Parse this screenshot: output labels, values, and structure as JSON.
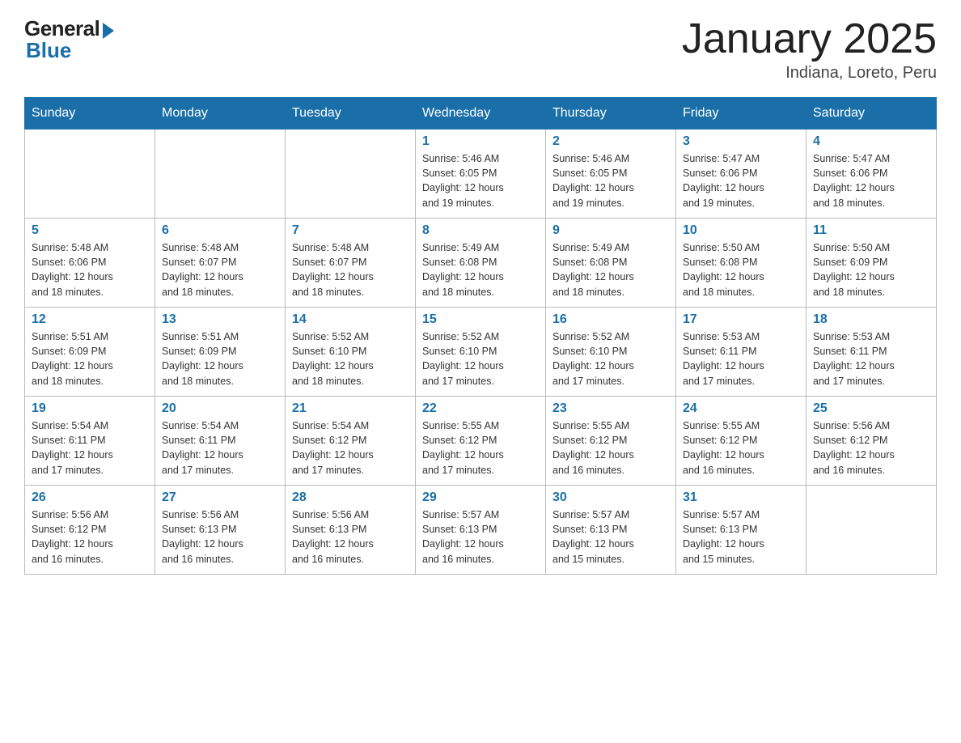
{
  "header": {
    "logo_general": "General",
    "logo_blue": "Blue",
    "title": "January 2025",
    "location": "Indiana, Loreto, Peru"
  },
  "days_of_week": [
    "Sunday",
    "Monday",
    "Tuesday",
    "Wednesday",
    "Thursday",
    "Friday",
    "Saturday"
  ],
  "weeks": [
    [
      {
        "day": "",
        "info": ""
      },
      {
        "day": "",
        "info": ""
      },
      {
        "day": "",
        "info": ""
      },
      {
        "day": "1",
        "info": "Sunrise: 5:46 AM\nSunset: 6:05 PM\nDaylight: 12 hours\nand 19 minutes."
      },
      {
        "day": "2",
        "info": "Sunrise: 5:46 AM\nSunset: 6:05 PM\nDaylight: 12 hours\nand 19 minutes."
      },
      {
        "day": "3",
        "info": "Sunrise: 5:47 AM\nSunset: 6:06 PM\nDaylight: 12 hours\nand 19 minutes."
      },
      {
        "day": "4",
        "info": "Sunrise: 5:47 AM\nSunset: 6:06 PM\nDaylight: 12 hours\nand 18 minutes."
      }
    ],
    [
      {
        "day": "5",
        "info": "Sunrise: 5:48 AM\nSunset: 6:06 PM\nDaylight: 12 hours\nand 18 minutes."
      },
      {
        "day": "6",
        "info": "Sunrise: 5:48 AM\nSunset: 6:07 PM\nDaylight: 12 hours\nand 18 minutes."
      },
      {
        "day": "7",
        "info": "Sunrise: 5:48 AM\nSunset: 6:07 PM\nDaylight: 12 hours\nand 18 minutes."
      },
      {
        "day": "8",
        "info": "Sunrise: 5:49 AM\nSunset: 6:08 PM\nDaylight: 12 hours\nand 18 minutes."
      },
      {
        "day": "9",
        "info": "Sunrise: 5:49 AM\nSunset: 6:08 PM\nDaylight: 12 hours\nand 18 minutes."
      },
      {
        "day": "10",
        "info": "Sunrise: 5:50 AM\nSunset: 6:08 PM\nDaylight: 12 hours\nand 18 minutes."
      },
      {
        "day": "11",
        "info": "Sunrise: 5:50 AM\nSunset: 6:09 PM\nDaylight: 12 hours\nand 18 minutes."
      }
    ],
    [
      {
        "day": "12",
        "info": "Sunrise: 5:51 AM\nSunset: 6:09 PM\nDaylight: 12 hours\nand 18 minutes."
      },
      {
        "day": "13",
        "info": "Sunrise: 5:51 AM\nSunset: 6:09 PM\nDaylight: 12 hours\nand 18 minutes."
      },
      {
        "day": "14",
        "info": "Sunrise: 5:52 AM\nSunset: 6:10 PM\nDaylight: 12 hours\nand 18 minutes."
      },
      {
        "day": "15",
        "info": "Sunrise: 5:52 AM\nSunset: 6:10 PM\nDaylight: 12 hours\nand 17 minutes."
      },
      {
        "day": "16",
        "info": "Sunrise: 5:52 AM\nSunset: 6:10 PM\nDaylight: 12 hours\nand 17 minutes."
      },
      {
        "day": "17",
        "info": "Sunrise: 5:53 AM\nSunset: 6:11 PM\nDaylight: 12 hours\nand 17 minutes."
      },
      {
        "day": "18",
        "info": "Sunrise: 5:53 AM\nSunset: 6:11 PM\nDaylight: 12 hours\nand 17 minutes."
      }
    ],
    [
      {
        "day": "19",
        "info": "Sunrise: 5:54 AM\nSunset: 6:11 PM\nDaylight: 12 hours\nand 17 minutes."
      },
      {
        "day": "20",
        "info": "Sunrise: 5:54 AM\nSunset: 6:11 PM\nDaylight: 12 hours\nand 17 minutes."
      },
      {
        "day": "21",
        "info": "Sunrise: 5:54 AM\nSunset: 6:12 PM\nDaylight: 12 hours\nand 17 minutes."
      },
      {
        "day": "22",
        "info": "Sunrise: 5:55 AM\nSunset: 6:12 PM\nDaylight: 12 hours\nand 17 minutes."
      },
      {
        "day": "23",
        "info": "Sunrise: 5:55 AM\nSunset: 6:12 PM\nDaylight: 12 hours\nand 16 minutes."
      },
      {
        "day": "24",
        "info": "Sunrise: 5:55 AM\nSunset: 6:12 PM\nDaylight: 12 hours\nand 16 minutes."
      },
      {
        "day": "25",
        "info": "Sunrise: 5:56 AM\nSunset: 6:12 PM\nDaylight: 12 hours\nand 16 minutes."
      }
    ],
    [
      {
        "day": "26",
        "info": "Sunrise: 5:56 AM\nSunset: 6:12 PM\nDaylight: 12 hours\nand 16 minutes."
      },
      {
        "day": "27",
        "info": "Sunrise: 5:56 AM\nSunset: 6:13 PM\nDaylight: 12 hours\nand 16 minutes."
      },
      {
        "day": "28",
        "info": "Sunrise: 5:56 AM\nSunset: 6:13 PM\nDaylight: 12 hours\nand 16 minutes."
      },
      {
        "day": "29",
        "info": "Sunrise: 5:57 AM\nSunset: 6:13 PM\nDaylight: 12 hours\nand 16 minutes."
      },
      {
        "day": "30",
        "info": "Sunrise: 5:57 AM\nSunset: 6:13 PM\nDaylight: 12 hours\nand 15 minutes."
      },
      {
        "day": "31",
        "info": "Sunrise: 5:57 AM\nSunset: 6:13 PM\nDaylight: 12 hours\nand 15 minutes."
      },
      {
        "day": "",
        "info": ""
      }
    ]
  ]
}
